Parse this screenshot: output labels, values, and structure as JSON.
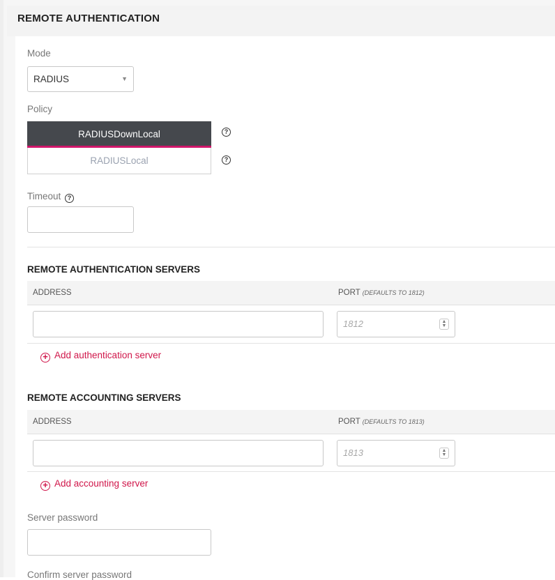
{
  "header": {
    "title": "REMOTE AUTHENTICATION"
  },
  "mode": {
    "label": "Mode",
    "value": "RADIUS"
  },
  "policy": {
    "label": "Policy",
    "options": [
      {
        "label": "RADIUSDownLocal",
        "active": true
      },
      {
        "label": "RADIUSLocal",
        "active": false
      }
    ],
    "help_glyph": "?"
  },
  "timeout": {
    "label": "Timeout",
    "value": ""
  },
  "auth_servers": {
    "title": "REMOTE AUTHENTICATION SERVERS",
    "col_address": "ADDRESS",
    "col_port": "PORT",
    "col_port_hint": "(DEFAULTS TO 1812)",
    "address_value": "",
    "port_placeholder": "1812",
    "add_label": "Add authentication server"
  },
  "acct_servers": {
    "title": "REMOTE ACCOUNTING SERVERS",
    "col_address": "ADDRESS",
    "col_port": "PORT",
    "col_port_hint": "(DEFAULTS TO 1813)",
    "address_value": "",
    "port_placeholder": "1813",
    "add_label": "Add accounting server"
  },
  "server_password": {
    "label": "Server password",
    "value": ""
  },
  "confirm_password": {
    "label": "Confirm server password"
  },
  "colors": {
    "accent": "#d0166a",
    "active_segment": "#45484d",
    "link": "#d0164a"
  }
}
